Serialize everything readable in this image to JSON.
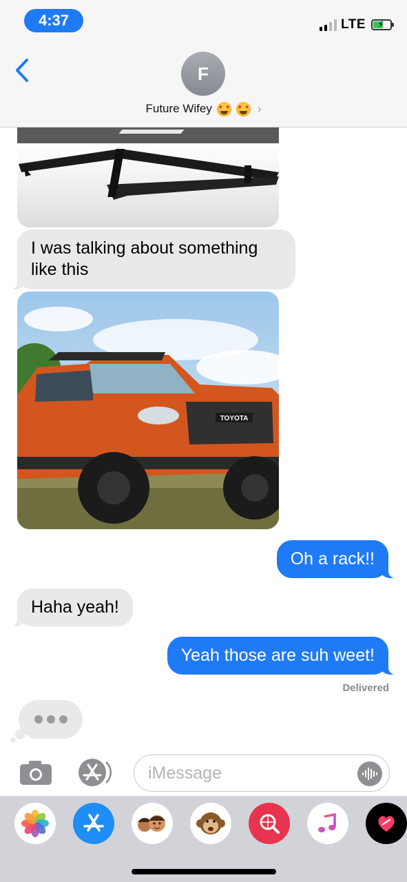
{
  "status_bar": {
    "time": "4:37",
    "network": "LTE"
  },
  "header": {
    "contact_initial": "F",
    "contact_name": "Future Wifey"
  },
  "messages": [
    {
      "direction": "incoming",
      "type": "image",
      "description_icon": "roof-rack-image"
    },
    {
      "direction": "incoming",
      "type": "text",
      "text": "I was talking about something like this"
    },
    {
      "direction": "incoming",
      "type": "image",
      "description_icon": "truck-image",
      "grille_text": "TOYOTA"
    },
    {
      "direction": "outgoing",
      "type": "text",
      "text": "Oh a rack!!"
    },
    {
      "direction": "incoming",
      "type": "text",
      "text": "Haha yeah!"
    },
    {
      "direction": "outgoing",
      "type": "text",
      "text": "Yeah those are suh weet!"
    }
  ],
  "delivery_status": "Delivered",
  "input": {
    "placeholder": "iMessage"
  },
  "app_drawer": [
    "photos-app-icon",
    "app-store-icon",
    "memoji-icon",
    "animoji-icon",
    "web-images-icon",
    "music-icon",
    "digital-touch-icon"
  ],
  "colors": {
    "accent": "#1f7af6",
    "incoming_bubble": "#e9e9eb",
    "drawer": "#d1d3d9"
  }
}
